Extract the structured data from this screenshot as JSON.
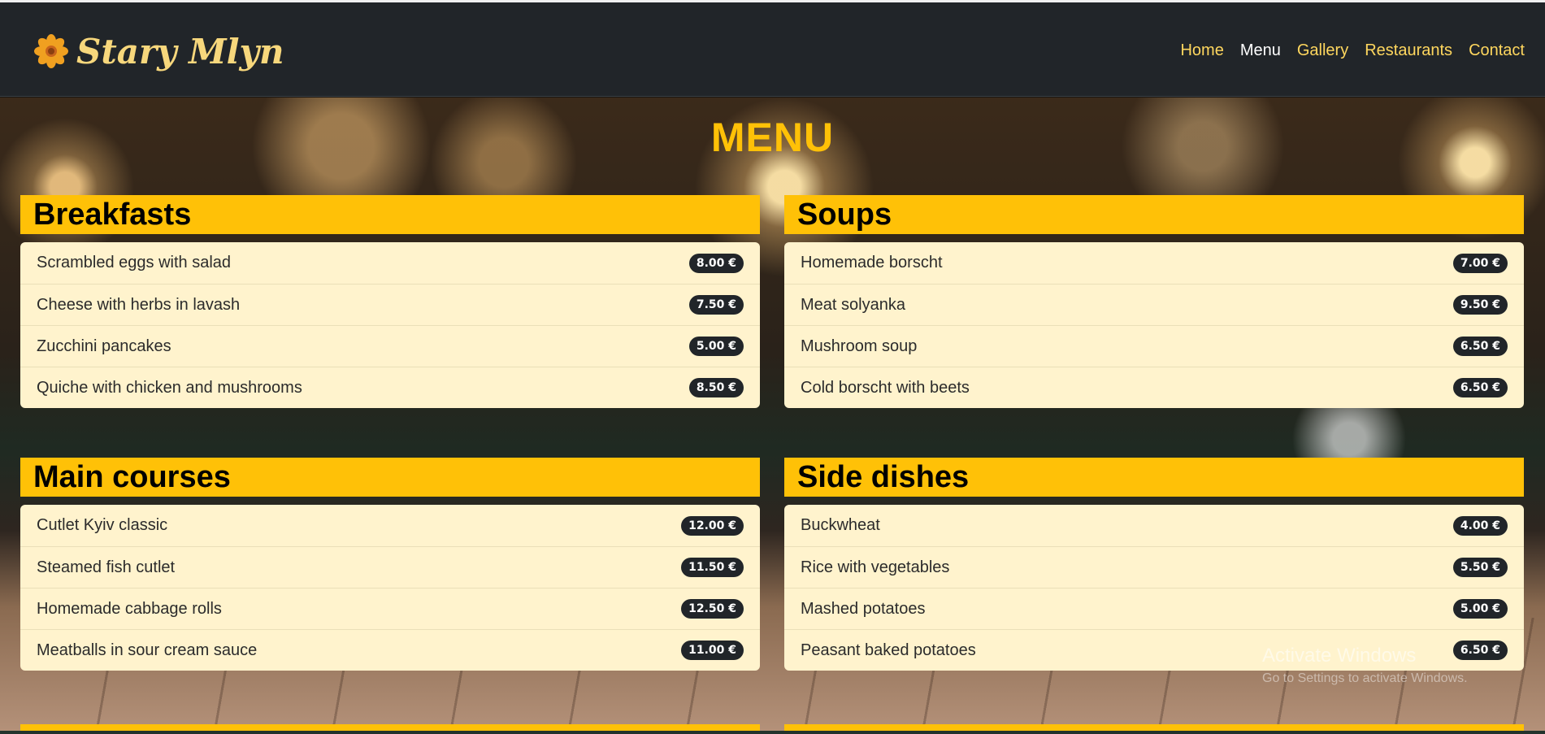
{
  "brand": {
    "name": "Stary Mlyn",
    "icon": "flower-icon"
  },
  "nav": [
    {
      "label": "Home",
      "active": false
    },
    {
      "label": "Menu",
      "active": true
    },
    {
      "label": "Gallery",
      "active": false
    },
    {
      "label": "Restaurants",
      "active": false
    },
    {
      "label": "Contact",
      "active": false
    }
  ],
  "page_title": "MENU",
  "sections": [
    {
      "title": "Breakfasts",
      "items": [
        {
          "name": "Scrambled eggs with salad",
          "price": "8.00 €"
        },
        {
          "name": "Cheese with herbs in lavash",
          "price": "7.50 €"
        },
        {
          "name": "Zucchini pancakes",
          "price": "5.00 €"
        },
        {
          "name": "Quiche with chicken and mushrooms",
          "price": "8.50 €"
        }
      ]
    },
    {
      "title": "Soups",
      "items": [
        {
          "name": "Homemade borscht",
          "price": "7.00 €"
        },
        {
          "name": "Meat solyanka",
          "price": "9.50 €"
        },
        {
          "name": "Mushroom soup",
          "price": "6.50 €"
        },
        {
          "name": "Cold borscht with beets",
          "price": "6.50 €"
        }
      ]
    },
    {
      "title": "Main courses",
      "items": [
        {
          "name": "Cutlet Kyiv classic",
          "price": "12.00 €"
        },
        {
          "name": "Steamed fish cutlet",
          "price": "11.50 €"
        },
        {
          "name": "Homemade cabbage rolls",
          "price": "12.50 €"
        },
        {
          "name": "Meatballs in sour cream sauce",
          "price": "11.00 €"
        }
      ]
    },
    {
      "title": "Side dishes",
      "items": [
        {
          "name": "Buckwheat",
          "price": "4.00 €"
        },
        {
          "name": "Rice with vegetables",
          "price": "5.50 €"
        },
        {
          "name": "Mashed potatoes",
          "price": "5.00 €"
        },
        {
          "name": "Peasant baked potatoes",
          "price": "6.50 €"
        }
      ]
    }
  ],
  "watermark": {
    "line1": "Activate Windows",
    "line2": "Go to Settings to activate Windows."
  },
  "colors": {
    "navbar": "#212529",
    "accent": "#ffc107",
    "nav_link": "#ffd75e",
    "list_bg": "#fff3cd",
    "badge": "#212529"
  }
}
